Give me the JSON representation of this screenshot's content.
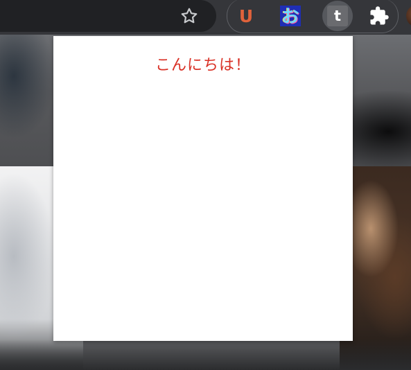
{
  "toolbar": {
    "bookmark_icon": "star-outline-icon",
    "extensions": [
      {
        "id": "u",
        "glyph": "U",
        "icon": "u-extension-icon",
        "color": "#e0623b"
      },
      {
        "id": "o",
        "glyph": "お",
        "icon": "hiragana-o-extension-icon",
        "color": "#1f2eb5"
      },
      {
        "id": "t",
        "glyph": "t",
        "icon": "t-extension-icon",
        "color": "#6a6b6f",
        "active": true
      }
    ],
    "extensions_menu_icon": "puzzle-piece-icon",
    "profile_icon": "profile-avatar-icon"
  },
  "popup": {
    "greeting": "こんにちは！",
    "greeting_color": "#d93025"
  }
}
